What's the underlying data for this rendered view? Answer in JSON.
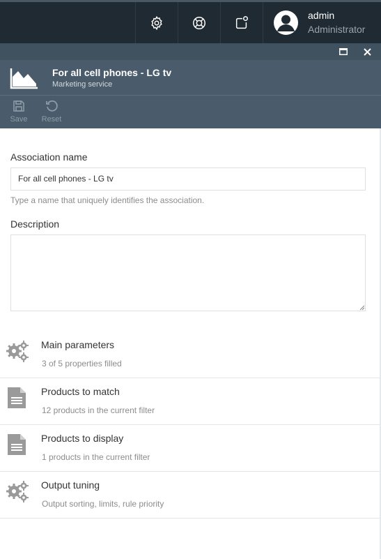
{
  "header": {
    "icons": [
      "settings-icon",
      "help-lifebuoy-icon",
      "notifications-icon"
    ],
    "user": {
      "name": "admin",
      "role": "Administrator"
    }
  },
  "blade": {
    "title": "For all cell phones - LG tv",
    "subtitle": "Marketing service",
    "icon": "area-chart-icon",
    "window_controls": [
      "maximize-icon",
      "close-icon"
    ]
  },
  "toolbar": {
    "save_label": "Save",
    "reset_label": "Reset"
  },
  "form": {
    "association_name_label": "Association name",
    "association_name_value": "For all cell phones - LG tv",
    "association_name_hint": "Type a name that uniquely identifies the association.",
    "description_label": "Description",
    "description_value": ""
  },
  "widgets": [
    {
      "icon": "gears-icon",
      "title": "Main parameters",
      "subtitle": "3 of 5 properties filled"
    },
    {
      "icon": "document-icon",
      "title": "Products to match",
      "subtitle": "12 products in the current filter"
    },
    {
      "icon": "document-icon",
      "title": "Products to display",
      "subtitle": "1 products in the current filter"
    },
    {
      "icon": "gears-icon",
      "title": "Output tuning",
      "subtitle": "Output sorting, limits, rule priority"
    }
  ],
  "colors": {
    "topbar": "#1f2a33",
    "blade_header": "#4a5c6b",
    "disabled_tool": "#8e9ba6",
    "icon_grey": "#9a9a9a"
  }
}
